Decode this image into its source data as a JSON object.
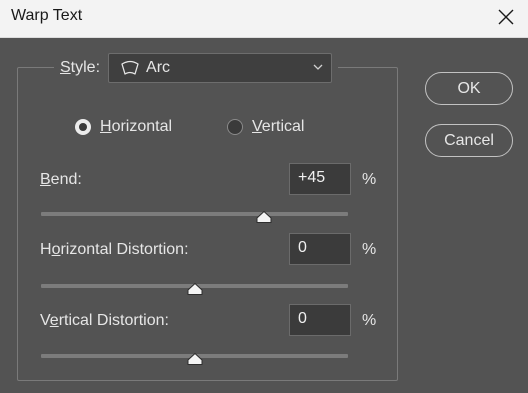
{
  "window": {
    "title": "Warp Text"
  },
  "style": {
    "label": "Style:",
    "label_key": "S",
    "label_rest": "tyle:",
    "value": "Arc",
    "icon": "arc-icon"
  },
  "orientation": {
    "horizontal": {
      "label": "Horizontal",
      "key": "H",
      "rest": "orizontal",
      "checked": true
    },
    "vertical": {
      "label": "Vertical",
      "key": "V",
      "rest": "ertical",
      "checked": false
    }
  },
  "bend": {
    "label": "Bend:",
    "key": "B",
    "rest": "end:",
    "value": "+45",
    "unit": "%",
    "level_percent": 45
  },
  "horizontal_distortion": {
    "label": "Horizontal Distortion:",
    "pre": "H",
    "key": "o",
    "rest": "rizontal Distortion:",
    "value": "0",
    "unit": "%",
    "level_percent": 0
  },
  "vertical_distortion": {
    "label": "Vertical Distortion:",
    "pre": "V",
    "key": "e",
    "rest": "rtical Distortion:",
    "value": "0",
    "unit": "%",
    "level_percent": 0
  },
  "buttons": {
    "ok": "OK",
    "cancel": "Cancel"
  },
  "colors": {
    "dialog_bg": "#535353",
    "titlebar_bg": "#f3f3f3",
    "text": "#e6e6e6",
    "input_bg": "#3b3b3b"
  }
}
